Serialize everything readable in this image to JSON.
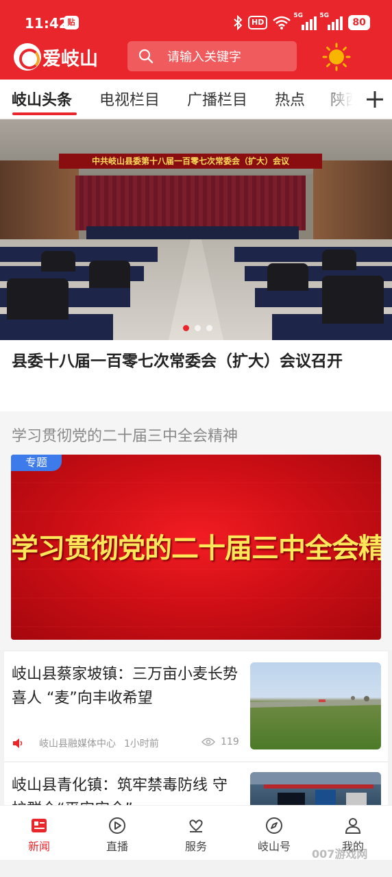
{
  "status_bar": {
    "time": "11:42",
    "badge": "贴",
    "hd": "HD",
    "net1": "5G",
    "net2": "5G",
    "battery": "80"
  },
  "header": {
    "logo_text": "爱岐山",
    "search_placeholder": "请输入关键字"
  },
  "tabs": [
    "岐山头条",
    "电视栏目",
    "广播栏目",
    "热点",
    "陕西"
  ],
  "banner": {
    "sign_text": "中共岐山县委第十八届一百零七次常委会（扩大）会议",
    "headline": "县委十八届一百零七次常委会（扩大）会议召开",
    "active_slide": 0,
    "slide_count": 3
  },
  "topic": {
    "title": "学习贯彻党的二十届三中全会精神",
    "tag": "专题",
    "banner_text": "学习贯彻党的二十届三中全会精神"
  },
  "news": [
    {
      "title": "岐山县蔡家坡镇：三万亩小麦长势喜人 “麦”向丰收希望",
      "source": "岐山县融媒体中心",
      "time": "1小时前",
      "views": "119"
    },
    {
      "title": "岐山县青化镇：筑牢禁毒防线 守护群众“平安安全”",
      "source": "",
      "time": "",
      "views": ""
    }
  ],
  "bottom_nav": [
    {
      "label": "新闻",
      "icon": "news-icon",
      "active": true
    },
    {
      "label": "直播",
      "icon": "play-icon",
      "active": false
    },
    {
      "label": "服务",
      "icon": "service-icon",
      "active": false
    },
    {
      "label": "岐山号",
      "icon": "compass-icon",
      "active": false
    },
    {
      "label": "我的",
      "icon": "user-icon",
      "active": false
    }
  ],
  "watermark": "007游戏网",
  "colors": {
    "brand": "#e8262b",
    "accent_blue": "#3d7bea",
    "headline_text": "#222222"
  }
}
